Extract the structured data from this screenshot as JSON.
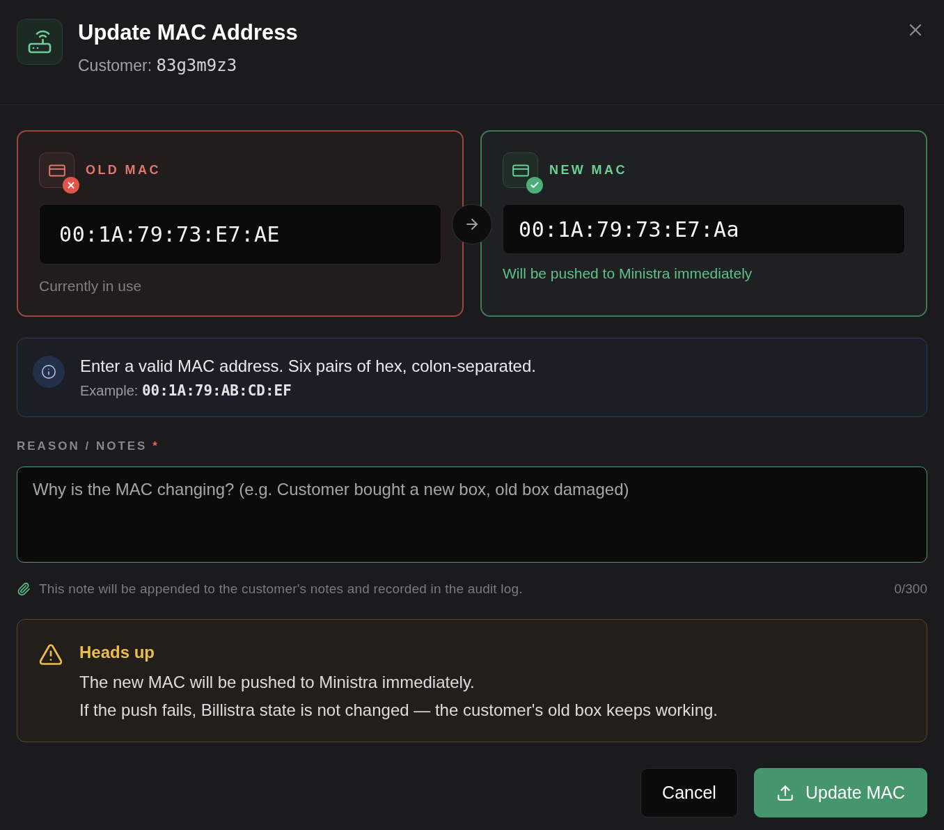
{
  "dialog": {
    "title": "Update MAC Address",
    "customer_label": "Customer:",
    "customer_id": "83g3m9z3"
  },
  "mac_cards": [
    {
      "kind": "old",
      "label": "OLD MAC",
      "value": "00:1A:79:73:E7:AE",
      "note": "Currently in use"
    },
    {
      "kind": "new",
      "label": "NEW MAC",
      "value": "00:1A:79:73:E7:Aa",
      "note": "Will be pushed to Ministra immediately"
    }
  ],
  "info": {
    "message": "Enter a valid MAC address. Six pairs of hex, colon-separated.",
    "example_label": "Example:",
    "example_value": "00:1A:79:AB:CD:EF"
  },
  "reason": {
    "label": "REASON / NOTES",
    "required_mark": "*",
    "placeholder": "Why is the MAC changing? (e.g. Customer bought a new box, old box damaged)",
    "hint": "This note will be appended to the customer's notes and recorded in the audit log.",
    "counter": "0/300"
  },
  "warning": {
    "title": "Heads up",
    "lines": [
      "The new MAC will be pushed to Ministra immediately.",
      "If the push fails, Billistra state is not changed — the customer's old box keeps working."
    ]
  },
  "buttons": [
    {
      "kind": "secondary",
      "label": "Cancel"
    },
    {
      "kind": "primary",
      "label": "Update MAC"
    }
  ]
}
